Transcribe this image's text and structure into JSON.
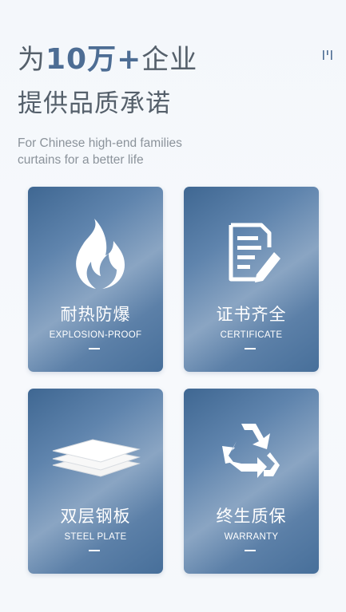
{
  "header": {
    "title_prefix": "为",
    "title_accent": "10万+",
    "title_suffix": "企业",
    "title_line2": "提供品质承诺",
    "subtitle_line1": "For Chinese high-end families",
    "subtitle_line2": "curtains for a better life"
  },
  "features": [
    {
      "cn": "耐热防爆",
      "en": "EXPLOSION-PROOF",
      "icon": "flame-icon"
    },
    {
      "cn": "证书齐全",
      "en": "CERTIFICATE",
      "icon": "document-pen-icon"
    },
    {
      "cn": "双层钢板",
      "en": "STEEL PLATE",
      "icon": "plate-layers-icon"
    },
    {
      "cn": "终生质保",
      "en": "WARRANTY",
      "icon": "recycle-icon"
    }
  ],
  "colors": {
    "accent": "#4d6d94",
    "card": "#5f84ad",
    "text": "#55606b"
  }
}
